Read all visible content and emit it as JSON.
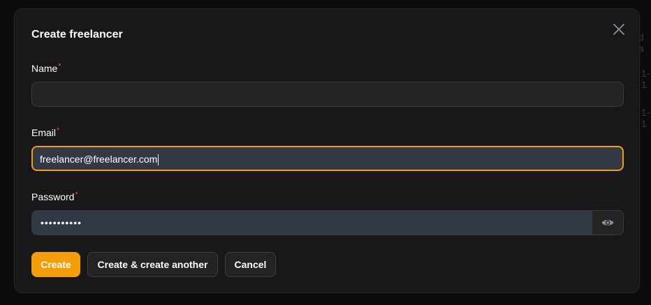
{
  "background": {
    "fragments": [
      "d a",
      "1-1",
      "1-1"
    ]
  },
  "modal": {
    "title": "Create freelancer",
    "close_icon": "close-icon",
    "fields": {
      "name": {
        "label": "Name",
        "required_mark": "*",
        "value": ""
      },
      "email": {
        "label": "Email",
        "required_mark": "*",
        "value": "freelancer@freelancer.com"
      },
      "password": {
        "label": "Password",
        "required_mark": "*",
        "masked_value": "••••••••••",
        "toggle_icon": "eye-icon"
      }
    },
    "actions": {
      "create_label": "Create",
      "create_another_label": "Create & create another",
      "cancel_label": "Cancel"
    }
  },
  "colors": {
    "accent": "#f59e0b",
    "required": "#ef4444",
    "modal_bg": "#18181b",
    "input_bg": "#232326",
    "focused_input_bg": "#323845"
  }
}
